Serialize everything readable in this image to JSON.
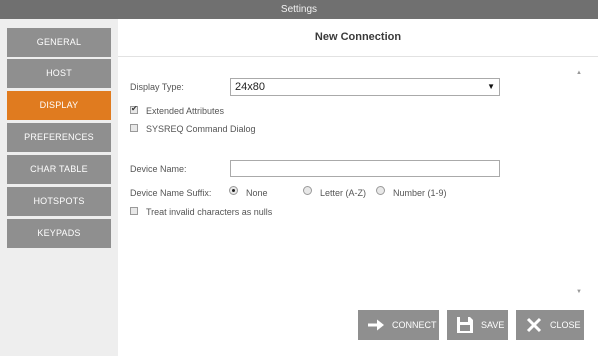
{
  "window": {
    "title": "Settings"
  },
  "sidebar": {
    "items": [
      {
        "label": "GENERAL",
        "active": false
      },
      {
        "label": "HOST",
        "active": false
      },
      {
        "label": "DISPLAY",
        "active": true
      },
      {
        "label": "PREFERENCES",
        "active": false
      },
      {
        "label": "CHAR TABLE",
        "active": false
      },
      {
        "label": "HOTSPOTS",
        "active": false
      },
      {
        "label": "KEYPADS",
        "active": false
      }
    ]
  },
  "header": {
    "title": "New Connection"
  },
  "form": {
    "display_type_label": "Display Type:",
    "display_type_value": "24x80",
    "extended_attributes_label": "Extended Attributes",
    "extended_attributes_checked": true,
    "sysreq_label": "SYSREQ Command Dialog",
    "sysreq_checked": false,
    "device_name_label": "Device Name:",
    "device_name_value": "",
    "suffix_label": "Device Name Suffix:",
    "suffix_options": [
      "None",
      "Letter (A-Z)",
      "Number (1-9)"
    ],
    "suffix_selected": "None",
    "treat_invalid_label": "Treat invalid characters as nulls",
    "treat_invalid_checked": false
  },
  "buttons": {
    "connect": "CONNECT",
    "save": "SAVE",
    "close": "CLOSE"
  },
  "colors": {
    "accent": "#e07b1f",
    "nav_bg": "#8f8f8f",
    "titlebar_bg": "#707070"
  }
}
